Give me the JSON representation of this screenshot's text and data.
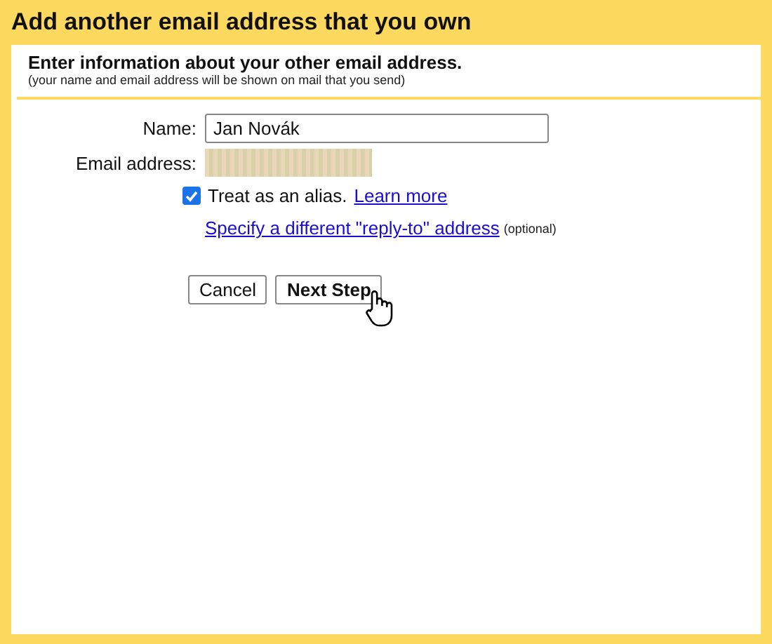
{
  "window": {
    "title": "Add another email address that you own"
  },
  "section": {
    "heading": "Enter information about your other email address.",
    "note": "(your name and email address will be shown on mail that you send)"
  },
  "form": {
    "name_label": "Name:",
    "name_value": "Jan Novák",
    "email_label": "Email address:",
    "email_redacted": true,
    "alias": {
      "checked": true,
      "label": "Treat as an alias.",
      "link": "Learn more"
    },
    "reply_to": {
      "link": "Specify a different \"reply-to\" address",
      "hint": "(optional)"
    }
  },
  "buttons": [
    {
      "label": "Cancel",
      "primary": false
    },
    {
      "label": "Next Step",
      "primary": true,
      "hovered": true
    }
  ]
}
